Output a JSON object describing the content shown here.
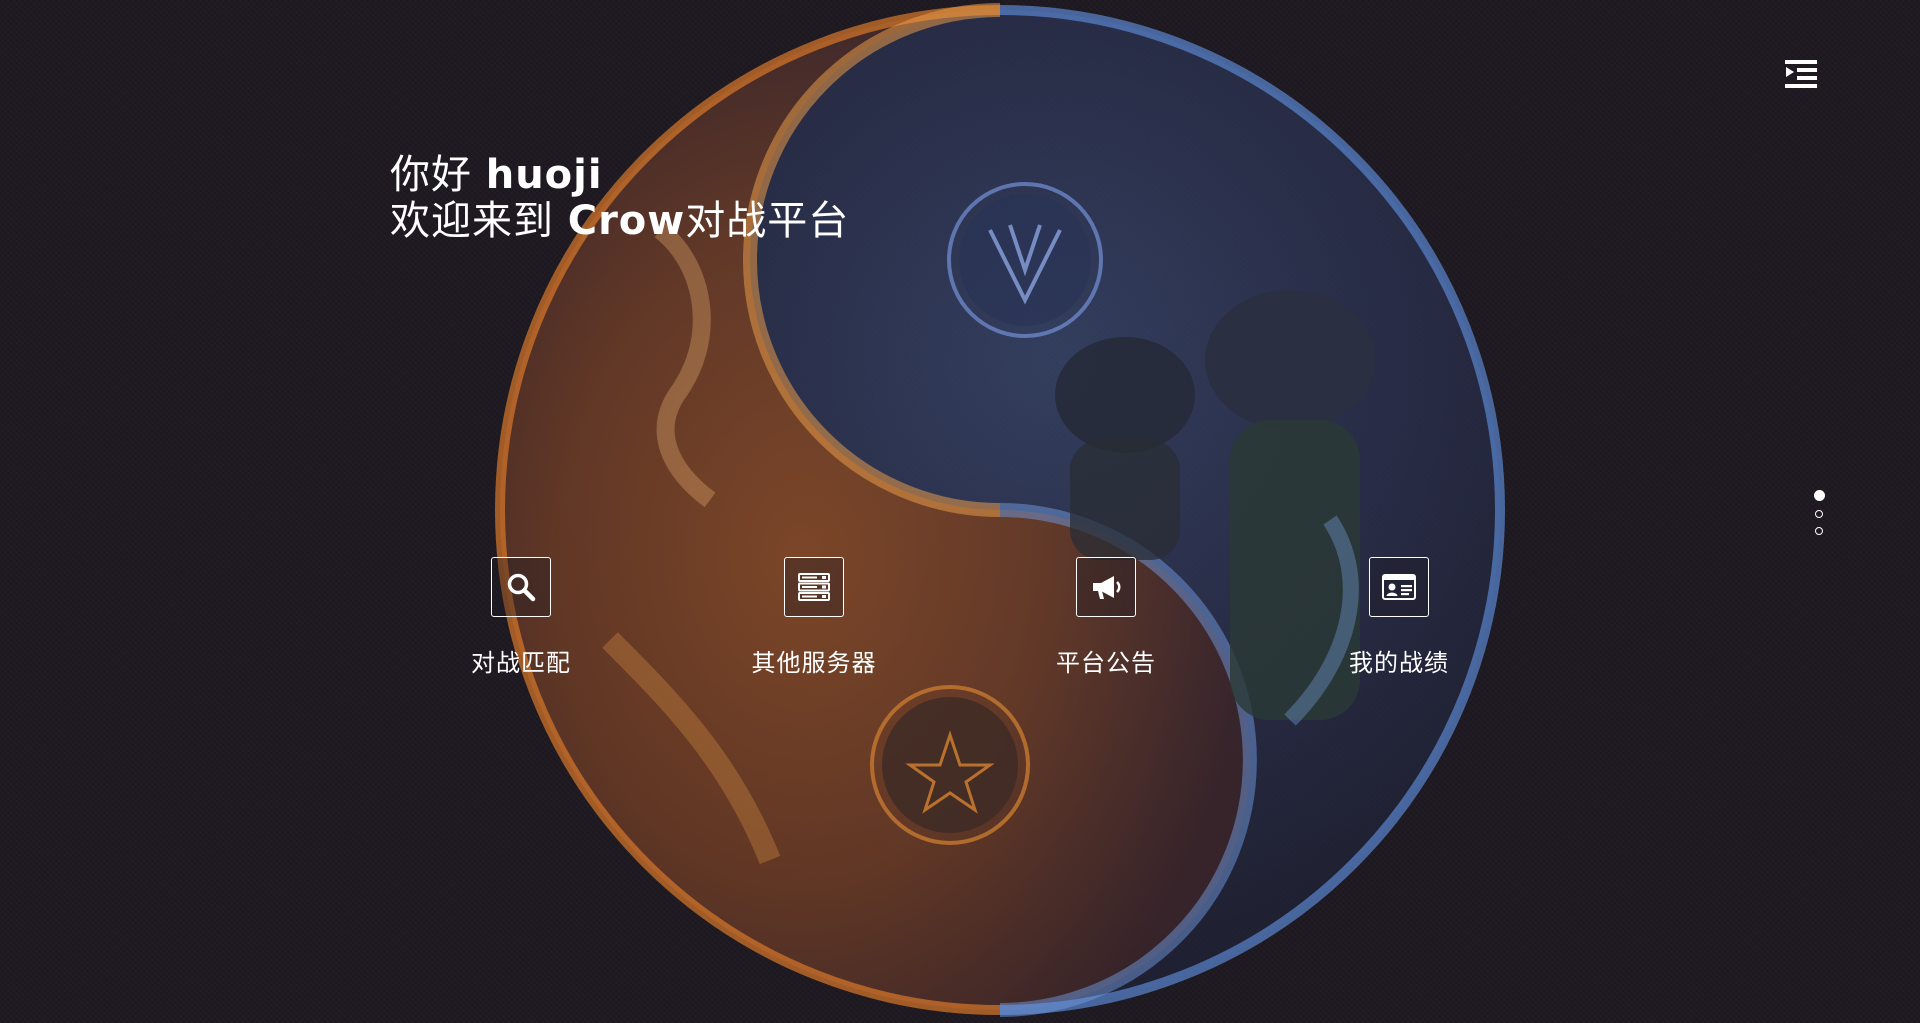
{
  "greeting": {
    "hello_prefix": "你好 ",
    "username": "huoji",
    "welcome_prefix": "欢迎来到 ",
    "platform_name": "Crow",
    "welcome_suffix": "对战平台"
  },
  "header": {
    "menu_icon": "menu-toggle-icon"
  },
  "features": [
    {
      "label": "对战匹配",
      "icon": "search-icon"
    },
    {
      "label": "其他服务器",
      "icon": "server-icon"
    },
    {
      "label": "平台公告",
      "icon": "megaphone-icon"
    },
    {
      "label": "我的战绩",
      "icon": "id-card-icon"
    }
  ],
  "pagination": {
    "total": 3,
    "active_index": 0
  },
  "colors": {
    "background": "#1f1a22",
    "text": "#ffffff",
    "fire": "#d9782a",
    "ice": "#4a6fb8"
  }
}
